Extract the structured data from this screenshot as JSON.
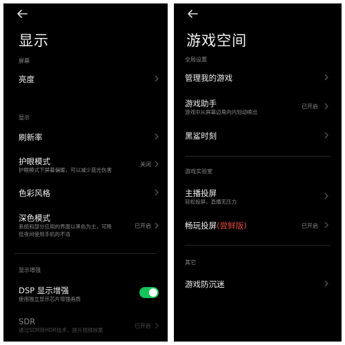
{
  "left": {
    "title": "显示",
    "section_screen": "屏幕",
    "brightness_label": "亮度",
    "section_display": "显示",
    "refresh_label": "刷新率",
    "eye_label": "护眼模式",
    "eye_sub": "护眼模式下屏幕偏暖，可以减少蓝光伤害",
    "eye_value": "关闭",
    "color_label": "色彩风格",
    "dark_label": "深色模式",
    "dark_sub_1": "系统和部分应用的界面以黑色为主，可降",
    "dark_sub_2": "低夜间使用手机的不适",
    "dark_value": "已开启",
    "section_enhance": "显示增强",
    "dsp_label": "DSP 显示增强",
    "dsp_sub": "使用独立显示芯片增强画质",
    "dsp_toggle_on": true,
    "hdr_label": "SDR",
    "hdr_sub": "通过SDR转HDR技术，提升视频效果",
    "hdr_value": "已开启"
  },
  "right": {
    "title": "游戏空间",
    "section_global": "全局设置",
    "manage_label": "管理我的游戏",
    "assistant_label": "游戏助手",
    "assistant_sub": "游戏中从屏幕边角向内划动唤出",
    "assistant_value": "已开启",
    "blackshark_label": "黑鲨时刻",
    "section_lab": "游戏实验室",
    "streamer_label": "主播投屏",
    "streamer_sub": "轻松投屏，直播无压力",
    "cast_label": "畅玩投屏",
    "cast_badge": "(尝鲜版)",
    "cast_value": "已开启",
    "section_other": "其它",
    "antiaddiction_label": "游戏防沉迷"
  },
  "colors": {
    "background": "#000000",
    "toggle_on": "#17c35b",
    "badge_red": "#e2483a"
  },
  "icons": {
    "back": "back-arrow-icon",
    "chevron": "chevron-right-icon"
  }
}
